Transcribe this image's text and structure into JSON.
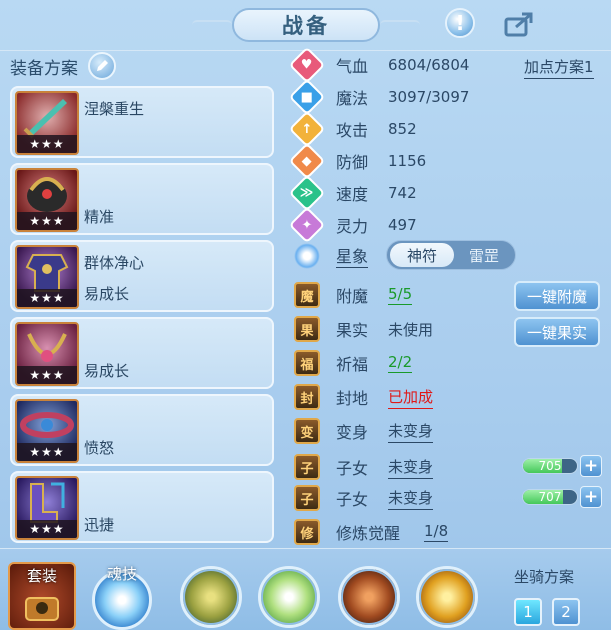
{
  "window": {
    "title": "战备"
  },
  "equipment": {
    "header": "装备方案",
    "slots": [
      {
        "line1": "涅槃重生",
        "line2": "",
        "stars": "★★★",
        "icon": "sword-icon"
      },
      {
        "line1": "",
        "line2": "精准",
        "stars": "★★★",
        "icon": "helmet-icon"
      },
      {
        "line1": "群体净心",
        "line2": "易成长",
        "stars": "★★★",
        "icon": "armor-icon"
      },
      {
        "line1": "",
        "line2": "易成长",
        "stars": "★★★",
        "icon": "necklace-icon"
      },
      {
        "line1": "",
        "line2": "愤怒",
        "stars": "★★★",
        "icon": "belt-icon"
      },
      {
        "line1": "",
        "line2": "迅捷",
        "stars": "★★★",
        "icon": "boots-icon"
      }
    ]
  },
  "stats": {
    "plan_link": "加点方案1",
    "rows": [
      {
        "label": "气血",
        "value": "6804/6804",
        "color": "#e85a7a",
        "glyph": "♥"
      },
      {
        "label": "魔法",
        "value": "3097/3097",
        "color": "#3aa0e8",
        "glyph": "■"
      },
      {
        "label": "攻击",
        "value": "852",
        "color": "#f2b23a",
        "glyph": "↑"
      },
      {
        "label": "防御",
        "value": "1156",
        "color": "#f08a4a",
        "glyph": "◆"
      },
      {
        "label": "速度",
        "value": "742",
        "color": "#2ac28a",
        "glyph": "≫"
      },
      {
        "label": "灵力",
        "value": "497",
        "color": "#c77ad8",
        "glyph": "✦"
      }
    ]
  },
  "astrology": {
    "label": "星象",
    "options": [
      "神符",
      "雷罡"
    ],
    "selected": "神符"
  },
  "enhance": [
    {
      "label": "附魔",
      "value": "5/5",
      "value_color": "#1a9a2a",
      "underline": true,
      "icon_glyph": "魔"
    },
    {
      "label": "果实",
      "value": "未使用",
      "value_color": "#2b4866",
      "underline": false,
      "icon_glyph": "果"
    },
    {
      "label": "祈福",
      "value": "2/2",
      "value_color": "#1a9a2a",
      "underline": true,
      "icon_glyph": "福"
    },
    {
      "label": "封地",
      "value": "已加成",
      "value_color": "#e01818",
      "underline": true,
      "icon_glyph": "封"
    },
    {
      "label": "变身",
      "value": "未变身",
      "value_color": "#2b4866",
      "underline": true,
      "icon_glyph": "变"
    },
    {
      "label": "子女",
      "value": "未变身",
      "value_color": "#2b4866",
      "underline": true,
      "icon_glyph": "子"
    },
    {
      "label": "子女",
      "value": "未变身",
      "value_color": "#2b4866",
      "underline": true,
      "icon_glyph": "子"
    },
    {
      "label": "修炼觉醒",
      "value": "1/8",
      "value_color": "#2b4866",
      "underline": true,
      "icon_glyph": "修"
    }
  ],
  "buttons": {
    "enchant_all": "一键附魔",
    "fruit_all": "一键果实"
  },
  "child_sliders": [
    {
      "value": "705",
      "fill": 0.72
    },
    {
      "value": "707",
      "fill": 0.74
    }
  ],
  "bottom": {
    "suit_label": "套装",
    "soul_label": "魂技",
    "mount_label": "坐骑方案",
    "mount_options": [
      "1",
      "2"
    ]
  }
}
